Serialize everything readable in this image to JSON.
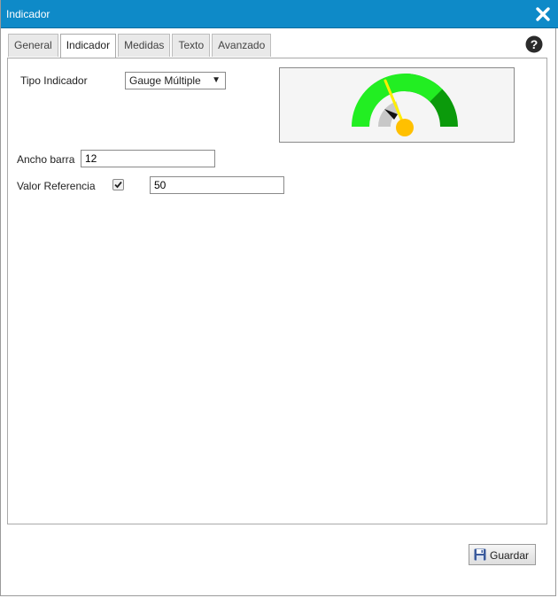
{
  "window": {
    "title": "Indicador"
  },
  "tabs": [
    {
      "label": "General",
      "active": false
    },
    {
      "label": "Indicador",
      "active": true
    },
    {
      "label": "Medidas",
      "active": false
    },
    {
      "label": "Texto",
      "active": false
    },
    {
      "label": "Avanzado",
      "active": false
    }
  ],
  "form": {
    "tipo_indicador": {
      "label": "Tipo Indicador",
      "value": "Gauge Múltiple"
    },
    "ancho_barra": {
      "label": "Ancho barra",
      "value": "12"
    },
    "valor_referencia": {
      "label": "Valor Referencia",
      "checked": true,
      "value": "50"
    }
  },
  "footer": {
    "save_label": "Guardar"
  },
  "colors": {
    "titlebar": "#0e8ac8",
    "gauge_bright_green": "#22ee22",
    "gauge_dark_green": "#0b9a0b",
    "gauge_inner_grey": "#c8c8c8",
    "needle_yellow": "#ffee00",
    "needle_hub": "#ffc000"
  },
  "icons": {
    "close": "close-icon",
    "help": "help-icon",
    "save": "floppy-disk-icon",
    "checkbox": "checkmark-icon"
  }
}
